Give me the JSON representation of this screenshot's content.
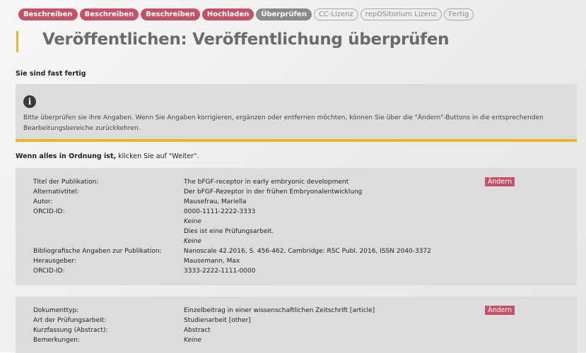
{
  "steps": [
    {
      "label": "Beschreiben",
      "state": "done"
    },
    {
      "label": "Beschreiben",
      "state": "done"
    },
    {
      "label": "Beschreiben",
      "state": "done"
    },
    {
      "label": "Hochladen",
      "state": "done"
    },
    {
      "label": "Überprüfen",
      "state": "current"
    },
    {
      "label": "CC-Lizenz",
      "state": "todo"
    },
    {
      "label": "repOSitorium Lizenz",
      "state": "todo"
    },
    {
      "label": "Fertig",
      "state": "todo"
    }
  ],
  "page_title": "Veröffentlichen: Veröffentlichung überprüfen",
  "subtitle": "Sie sind fast fertig",
  "info_icon": "info-icon",
  "info_text": "Bitte überprüfen sie ihre Angaben. Wenn Sie Angaben korrigieren, ergänzen oder entfernen möchten, können Sie über die \"Ändern\"-Buttons in die entsprechenden Bearbeitungsbereiche zurückkehren.",
  "proceed": {
    "bold": "Wenn alles in Ordnung ist,",
    "rest": " klicken Sie auf \"Weiter\"."
  },
  "edit_label": "Ändern",
  "section1": {
    "rows": [
      {
        "label": "Titel der Publikation:",
        "value": "The bFGF-receptor in early embryonic development"
      },
      {
        "label": "Alternativtitel:",
        "value": "Der bFGF-Rezeptor in der frühen Embryonalentwicklung"
      },
      {
        "label": "Autor:",
        "value": "Mausefrau, Mariella"
      },
      {
        "label": "ORCID-ID:",
        "value": "0000-1111-2222-3333"
      },
      {
        "label": "",
        "value": "Keine",
        "italic": true
      },
      {
        "label": "",
        "value": "Dies ist eine Prüfungsarbeit."
      },
      {
        "label": "",
        "value": "Keine",
        "italic": true
      },
      {
        "label": "Bibliografische Angaben zur Publikation:",
        "value": "Nanoscale 42.2016, S. 456-462, Cambridge: RSC Publ. 2016, ISSN 2040-3372"
      },
      {
        "label": "Herausgeber:",
        "value": "Mausemann, Max"
      },
      {
        "label": "ORCID-ID:",
        "value": "3333-2222-1111-0000"
      }
    ]
  },
  "section2": {
    "rows": [
      {
        "label": "Dokumenttyp:",
        "value": "Einzelbeitrag in einer wissenschaftlichen Zeitschrift [article]"
      },
      {
        "label": "Art der Prüfungsarbeit:",
        "value": "Studienarbeit [other]"
      },
      {
        "label": "Kurzfassung (Abstract):",
        "value": "Abstract"
      },
      {
        "label": "Bemerkungen:",
        "value": "Keine",
        "italic": true
      }
    ]
  },
  "colors": {
    "step_done": "#c2516a",
    "step_current": "#8a8a8a",
    "accent": "#f0b429",
    "panel": "#dcdcdc"
  }
}
